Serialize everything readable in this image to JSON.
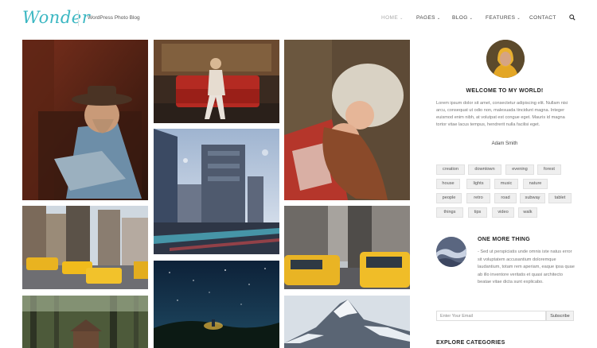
{
  "header": {
    "logo": "Wonder",
    "tagline": "WordPress Photo Blog",
    "nav": [
      {
        "label": "HOME",
        "active": true,
        "dropdown": true
      },
      {
        "label": "PAGES",
        "active": false,
        "dropdown": true
      },
      {
        "label": "BLOG",
        "active": false,
        "dropdown": true
      },
      {
        "label": "FEATURES",
        "active": false,
        "dropdown": true
      },
      {
        "label": "CONTACT",
        "active": false,
        "dropdown": false
      }
    ],
    "search_icon": "search-icon"
  },
  "sidebar": {
    "about": {
      "title": "WELCOME TO MY WORLD!",
      "text": "Lorem ipsum dolor sit amet, consectetur adipiscing elit. Nullam nisi arcu, consequat ut odio non, malesuada tincidunt magna. Integer euismod enim nibh, at volutpat est congue eget. Mauris id magna tortor vitae lacus tempus, hendrerit nulla facilisi eget.",
      "signature": "Adam Smith"
    },
    "tags": [
      "creation",
      "downtown",
      "evening",
      "forest",
      "house",
      "lights",
      "music",
      "nature",
      "people",
      "retro",
      "road",
      "subway",
      "tablet",
      "things",
      "tips",
      "video",
      "walk"
    ],
    "featured_post": {
      "title": "ONE MORE THING",
      "excerpt": "- Sed ut perspiciatis unde omnis iste natus error sit voluptatem accusantium doloremque laudantium, totam rem aperiam, eaque ipsa quae ab illo inventore veritatis et quasi architecto beatae vitae dicta sunt explicabo."
    },
    "newsletter": {
      "placeholder": "Enter Your Email",
      "button": "Subscribe"
    },
    "explore_title": "EXPLORE CATEGORIES"
  },
  "colors": {
    "brand": "#3bb7c2",
    "tag_bg": "#efefef",
    "text_muted": "#777777"
  }
}
